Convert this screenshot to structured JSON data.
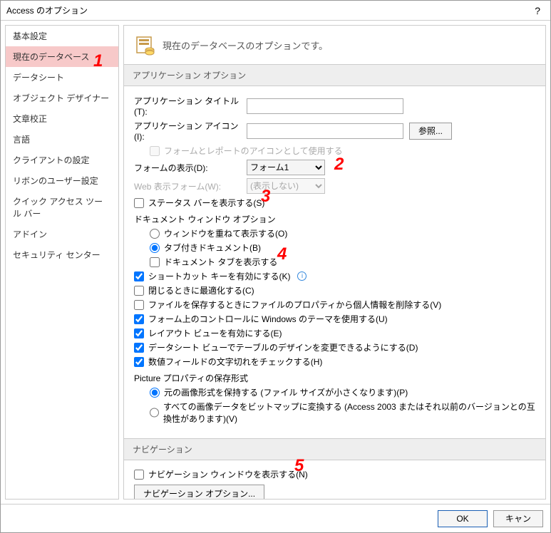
{
  "window": {
    "title": "Access のオプション",
    "help": "?"
  },
  "sidebar": {
    "items": [
      {
        "label": "基本設定"
      },
      {
        "label": "現在のデータベース"
      },
      {
        "label": "データシート"
      },
      {
        "label": "オブジェクト デザイナー"
      },
      {
        "label": "文章校正"
      },
      {
        "label": "言語"
      },
      {
        "label": "クライアントの設定"
      },
      {
        "label": "リボンのユーザー設定"
      },
      {
        "label": "クイック アクセス ツール バー"
      },
      {
        "label": "アドイン"
      },
      {
        "label": "セキュリティ センター"
      }
    ],
    "active_index": 1
  },
  "header": {
    "text": "現在のデータベースのオプションです。"
  },
  "sections": {
    "app": {
      "title": "アプリケーション オプション",
      "app_title_label": "アプリケーション タイトル(T):",
      "app_title_value": "",
      "app_icon_label": "アプリケーション アイコン(I):",
      "app_icon_value": "",
      "browse_btn": "参照...",
      "use_as_icon_label": "フォームとレポートのアイコンとして使用する",
      "display_form_label": "フォームの表示(D):",
      "display_form_value": "フォーム1",
      "web_form_label": "Web 表示フォーム(W):",
      "web_form_value": "(表示しない)",
      "status_bar_label": "ステータス バーを表示する(S)",
      "doc_window_label": "ドキュメント ウィンドウ オプション",
      "overlapping_label": "ウィンドウを重ねて表示する(O)",
      "tabbed_label": "タブ付きドキュメント(B)",
      "show_tabs_label": "ドキュメント タブを表示する",
      "shortcut_label": "ショートカット キーを有効にする(K)",
      "compact_label": "閉じるときに最適化する(C)",
      "remove_info_label": "ファイルを保存するときにファイルのプロパティから個人情報を削除する(V)",
      "themed_label": "フォーム上のコントロールに Windows のテーマを使用する(U)",
      "layout_label": "レイアウト ビューを有効にする(E)",
      "datasheet_design_label": "データシート ビューでテーブルのデザインを変更できるようにする(D)",
      "truncated_label": "数値フィールドの文字切れをチェックする(H)",
      "picture_group_label": "Picture プロパティの保存形式",
      "picture_preserve_label": "元の画像形式を保持する (ファイル サイズが小さくなります)(P)",
      "picture_convert_label": "すべての画像データをビットマップに変換する (Access 2003 またはそれ以前のバージョンとの互換性があります)(V)"
    },
    "nav": {
      "title": "ナビゲーション",
      "show_nav_label": "ナビゲーション ウィンドウを表示する(N)",
      "nav_options_btn": "ナビゲーション オプション..."
    }
  },
  "footer": {
    "ok": "OK",
    "cancel": "キャン"
  },
  "annotations": {
    "a1": "1",
    "a2": "2",
    "a3": "3",
    "a4": "4",
    "a5": "5"
  }
}
